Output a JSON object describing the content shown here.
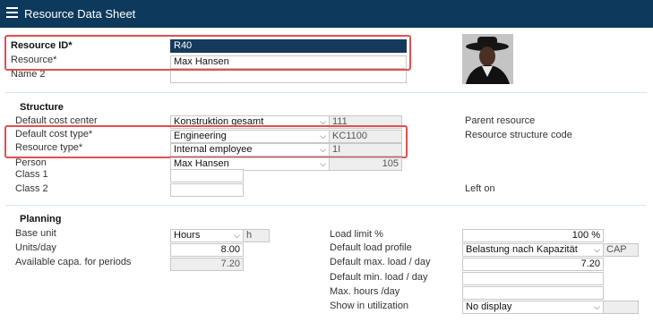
{
  "window": {
    "title": "Resource Data Sheet"
  },
  "header": {
    "resource_id_label": "Resource ID*",
    "resource_id_value": "R40",
    "resource_label": "Resource*",
    "resource_value": "Max Hansen",
    "name2_label": "Name 2",
    "name2_value": ""
  },
  "structure": {
    "title": "Structure",
    "cost_center_label": "Default cost center",
    "cost_center_value": "Konstruktion gesamt",
    "cost_center_code": "111",
    "cost_type_label": "Default cost type*",
    "cost_type_value": "Engineering",
    "cost_type_code": "KC1100",
    "resource_type_label": "Resource type*",
    "resource_type_value": "Internal employee",
    "resource_type_code": "1I",
    "person_label": "Person",
    "person_value": "Max Hansen",
    "person_code": "105",
    "class1_label": "Class 1",
    "class1_value": "",
    "class2_label": "Class 2",
    "class2_value": "",
    "parent_resource_label": "Parent resource",
    "structure_code_label": "Resource structure code",
    "left_on_label": "Left on"
  },
  "planning": {
    "title": "Planning",
    "base_unit_label": "Base unit",
    "base_unit_value": "Hours",
    "base_unit_code": "h",
    "units_day_label": "Units/day",
    "units_day_value": "8.00",
    "avail_capa_label": "Available capa. for periods",
    "avail_capa_value": "7.20",
    "load_limit_label": "Load limit %",
    "load_limit_value": "100 %",
    "load_profile_label": "Default load profile",
    "load_profile_value": "Belastung nach Kapazität",
    "load_profile_code": "CAP",
    "max_load_label": "Default max. load / day",
    "max_load_value": "7.20",
    "min_load_label": "Default min. load / day",
    "min_load_value": "",
    "max_hours_label": "Max. hours /day",
    "max_hours_value": "",
    "show_util_label": "Show in utilization",
    "show_util_value": "No display"
  }
}
